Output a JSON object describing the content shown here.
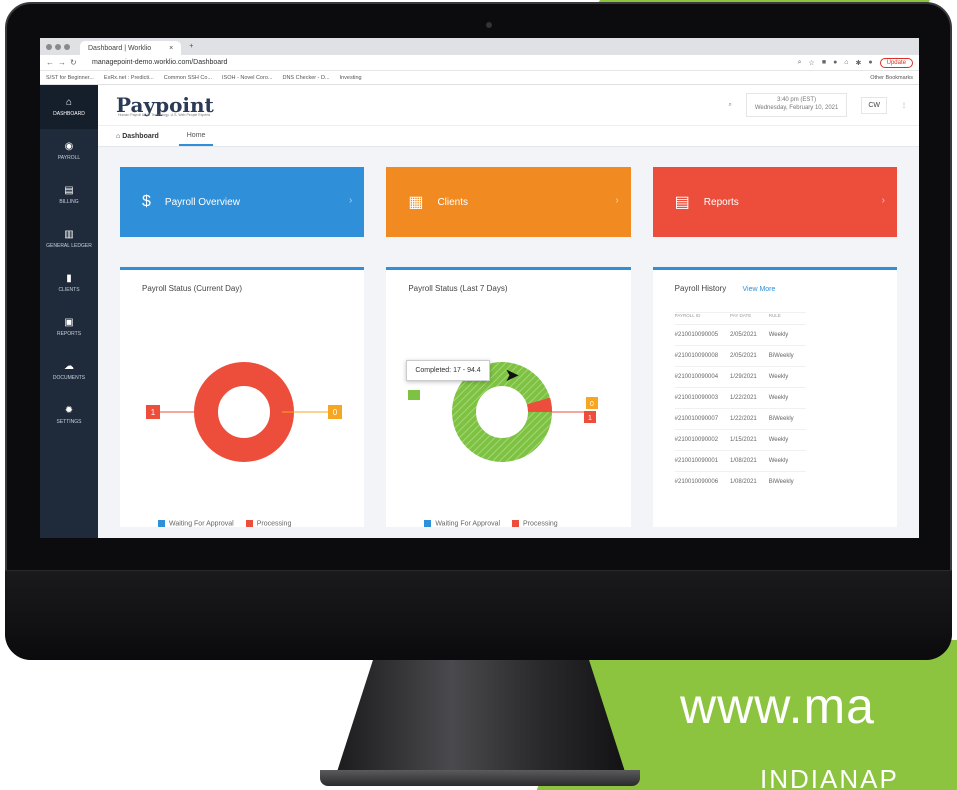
{
  "browser": {
    "tab_title": "Dashboard | Worklio",
    "tab_close": "×",
    "new_tab": "+",
    "url": "managepoint-demo.worklio.com/Dashboard",
    "update_label": "Update",
    "bookmarks": [
      "S/ST for Beginner...",
      "ExRx.net : Predicti...",
      "Common SSH Co...",
      "ISOH - Novel Coro...",
      "DNS Checker - D...",
      "Investing"
    ],
    "other_bookmarks": "Other Bookmarks"
  },
  "sidebar": {
    "items": [
      {
        "label": "Dashboard",
        "icon": "home-icon",
        "glyph": "⌂"
      },
      {
        "label": "Payroll",
        "icon": "payroll-icon",
        "glyph": "◉"
      },
      {
        "label": "Billing",
        "icon": "billing-icon",
        "glyph": "▤"
      },
      {
        "label": "General Ledger",
        "icon": "ledger-icon",
        "glyph": "▥"
      },
      {
        "label": "Clients",
        "icon": "clients-icon",
        "glyph": "▮"
      },
      {
        "label": "Reports",
        "icon": "reports-icon",
        "glyph": "▣"
      },
      {
        "label": "Documents",
        "icon": "cloud-icon",
        "glyph": "☁"
      },
      {
        "label": "Settings",
        "icon": "gear-icon",
        "glyph": "✹"
      }
    ]
  },
  "header": {
    "logo": "Paypoint",
    "tagline": "Human Payroll & HR Technology. U.S. Web People Experts",
    "time": "3:40 pm (EST)",
    "date": "Wednesday, February 10, 2021",
    "user_initials": "CW"
  },
  "breadcrumb": {
    "home": "Dashboard",
    "tab": "Home"
  },
  "tiles": [
    {
      "label": "Payroll Overview",
      "color": "#2f8fd8",
      "icon": "dollar-icon",
      "glyph": "$"
    },
    {
      "label": "Clients",
      "color": "#f18b21",
      "icon": "building-icon",
      "glyph": "▦"
    },
    {
      "label": "Reports",
      "color": "#ed4e3b",
      "icon": "report-icon",
      "glyph": "▤"
    }
  ],
  "cards": {
    "current_day": {
      "title": "Payroll Status (Current Day)",
      "label_left": "1",
      "label_right": "0",
      "legend": [
        "Waiting For Approval",
        "Processing"
      ]
    },
    "last7": {
      "title": "Payroll Status (Last 7 Days)",
      "tooltip": "Completed: 17 - 94.4",
      "label_right_top": "0",
      "label_right_bottom": "1",
      "legend": [
        "Waiting For Approval",
        "Processing"
      ]
    },
    "history": {
      "title": "Payroll History",
      "view_more": "View More",
      "columns": [
        "PAYROLL ID",
        "PAY DATE",
        "RULE"
      ],
      "rows": [
        [
          "#210010090005",
          "2/05/2021",
          "Weekly"
        ],
        [
          "#210010090008",
          "2/05/2021",
          "BiWeekly"
        ],
        [
          "#210010090004",
          "1/29/2021",
          "Weekly"
        ],
        [
          "#210010090003",
          "1/22/2021",
          "Weekly"
        ],
        [
          "#210010090007",
          "1/22/2021",
          "BiWeekly"
        ],
        [
          "#210010090002",
          "1/15/2021",
          "Weekly"
        ],
        [
          "#210010090001",
          "1/08/2021",
          "Weekly"
        ],
        [
          "#210010090006",
          "1/08/2021",
          "BiWeekly"
        ]
      ]
    }
  },
  "colors": {
    "waiting": "#2f8fd8",
    "processing": "#ed4e3b",
    "completed": "#7dc243",
    "warning": "#f5a623"
  },
  "promo": {
    "url": "www.ma",
    "city": "INDIANAP"
  }
}
